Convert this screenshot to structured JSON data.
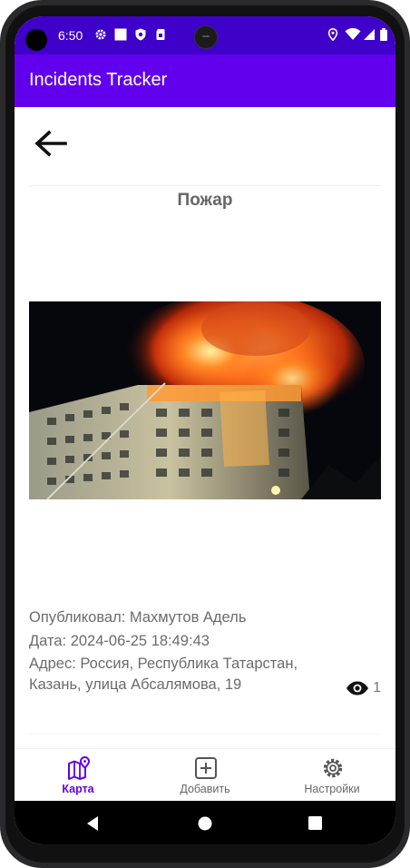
{
  "status_bar": {
    "time": "6:50",
    "left_icons": [
      "gear-icon",
      "square-icon",
      "shield-icon",
      "sim-card-icon"
    ],
    "right_icons": [
      "location-icon",
      "wifi-icon",
      "signal-icon",
      "battery-icon"
    ]
  },
  "app_bar": {
    "title": "Incidents Tracker",
    "background": "#6200ee"
  },
  "incident": {
    "title": "Пожар",
    "published_by": "Опубликовал: Махмутов Адель",
    "date": "Дата: 2024-06-25 18:49:43",
    "address_line1": "Адрес: Россия, Республика Татарстан,",
    "address_line2": "Казань, улица Абсалямова, 19",
    "views": "1",
    "image_icon": "fire-photo"
  },
  "bottom_nav": {
    "items": [
      {
        "label": "Карта",
        "icon": "map-pin-icon",
        "active": true
      },
      {
        "label": "Добавить",
        "icon": "add-box-icon",
        "active": false
      },
      {
        "label": "Настройки",
        "icon": "settings-icon",
        "active": false
      }
    ],
    "active_color": "#6200ee"
  },
  "system_nav": [
    "back-icon",
    "home-icon",
    "recents-icon"
  ]
}
